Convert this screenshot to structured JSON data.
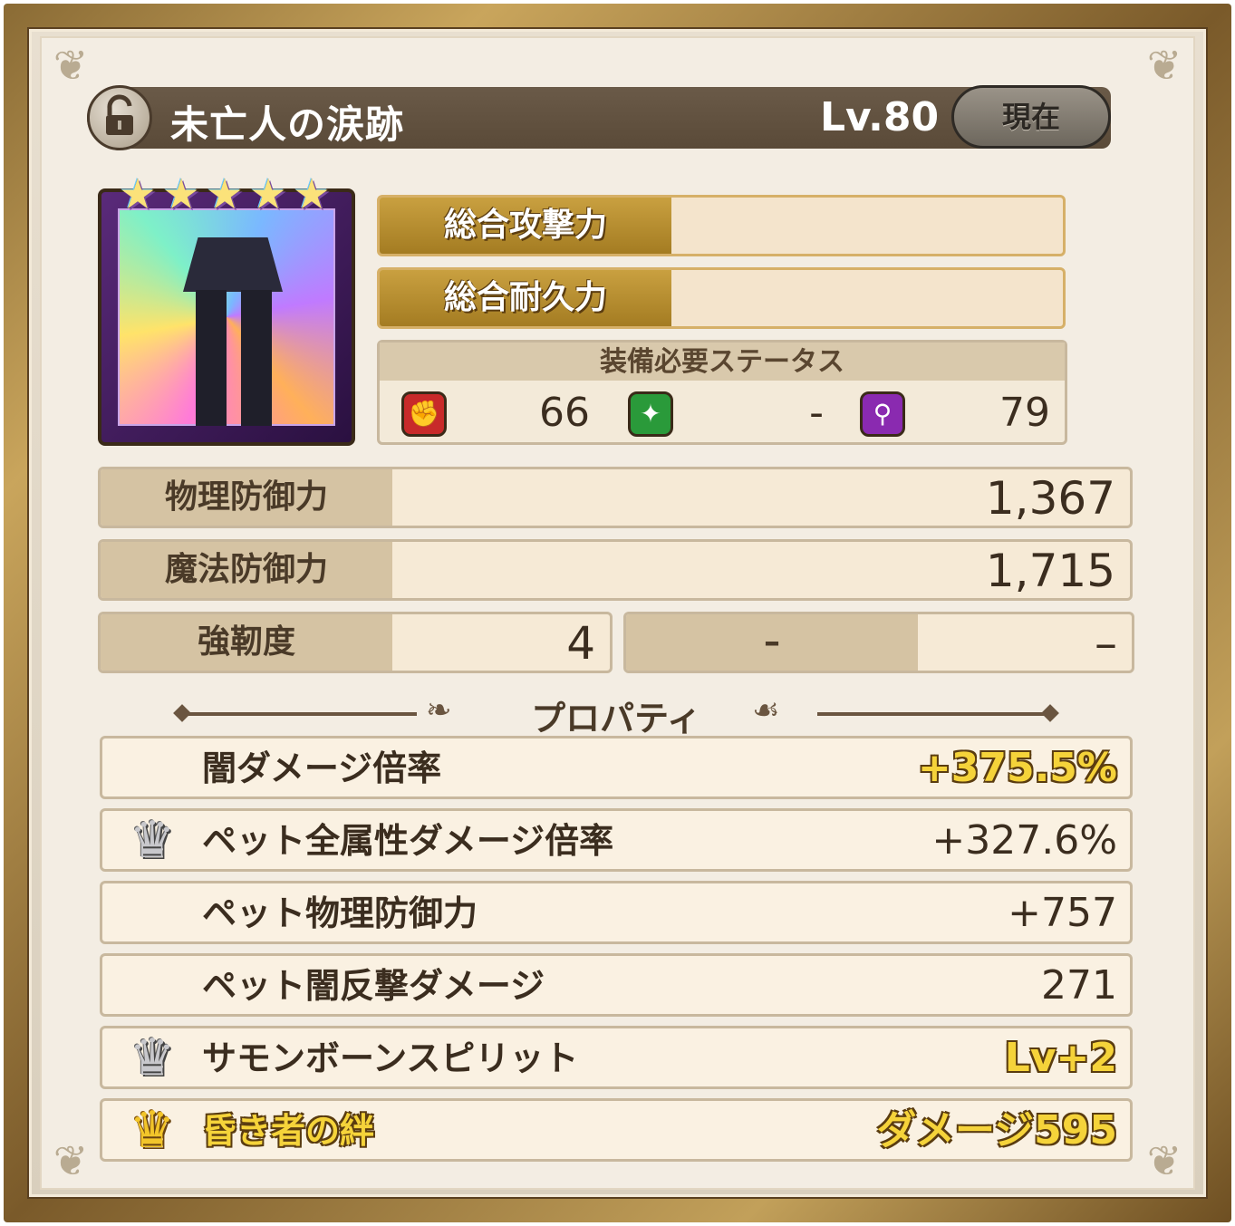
{
  "header": {
    "title": "未亡人の涙跡",
    "level": "Lv.80",
    "current_label": "現在",
    "lock_icon": "unlocked-padlock-icon"
  },
  "item": {
    "rarity_stars": 5,
    "icon": "black-skirt-stockings-equipment-icon"
  },
  "totals": {
    "attack_label": "総合攻撃力",
    "durability_label": "総合耐久力"
  },
  "requirements": {
    "title": "装備必要ステータス",
    "stats": [
      {
        "icon": "strength-fist-icon",
        "value": "66",
        "color": "#c82a2a"
      },
      {
        "icon": "agility-green-icon",
        "value": "-",
        "color": "#2a9a3a"
      },
      {
        "icon": "magic-wand-icon",
        "value": "79",
        "color": "#8a2ab0"
      }
    ]
  },
  "stats": {
    "physical_defense_label": "物理防御力",
    "physical_defense_value": "1,367",
    "magic_defense_label": "魔法防御力",
    "magic_defense_value": "1,715",
    "toughness_label": "強靭度",
    "toughness_value": "4",
    "extra_label": "–",
    "extra_value": "–"
  },
  "properties": {
    "title": "プロパティ",
    "items": [
      {
        "name": "闇ダメージ倍率",
        "value": "+375.5%",
        "crown": "",
        "highlight_value": true,
        "highlight_name": false
      },
      {
        "name": "ペット全属性ダメージ倍率",
        "value": "+327.6%",
        "crown": "silver",
        "highlight_value": false,
        "highlight_name": false
      },
      {
        "name": "ペット物理防御力",
        "value": "+757",
        "crown": "",
        "highlight_value": false,
        "highlight_name": false
      },
      {
        "name": "ペット闇反撃ダメージ",
        "value": "271",
        "crown": "",
        "highlight_value": false,
        "highlight_name": false
      },
      {
        "name": "サモンボーンスピリット",
        "value": "Lv+2",
        "crown": "silver",
        "highlight_value": true,
        "highlight_name": false
      },
      {
        "name": "昏き者の絆",
        "value": "ダメージ595",
        "crown": "gold",
        "highlight_value": true,
        "highlight_name": true
      }
    ]
  },
  "colors": {
    "gold_label": "#b88d2e",
    "panel_bg": "#f3ede3",
    "title_bar": "#5f4f3d"
  }
}
